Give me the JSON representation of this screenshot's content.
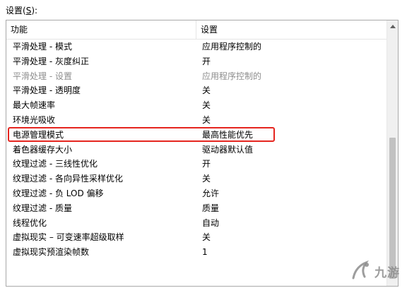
{
  "section_label": {
    "prefix": "设置(",
    "accel": "S",
    "suffix": "):"
  },
  "table": {
    "headers": {
      "feature": "功能",
      "setting": "设置"
    },
    "rows": [
      {
        "feature": "平滑处理 - 模式",
        "setting": "应用程序控制的",
        "disabled": false
      },
      {
        "feature": "平滑处理 - 灰度纠正",
        "setting": "开",
        "disabled": false
      },
      {
        "feature": "平滑处理 - 设置",
        "setting": "应用程序控制的",
        "disabled": true
      },
      {
        "feature": "平滑处理 - 透明度",
        "setting": "关",
        "disabled": false
      },
      {
        "feature": "最大帧速率",
        "setting": "关",
        "disabled": false
      },
      {
        "feature": "环境光吸收",
        "setting": "关",
        "disabled": false
      },
      {
        "feature": "电源管理模式",
        "setting": "最高性能优先",
        "disabled": false,
        "highlighted": true
      },
      {
        "feature": "着色器缓存大小",
        "setting": "驱动器默认值",
        "disabled": false
      },
      {
        "feature": "纹理过滤 - 三线性优化",
        "setting": "开",
        "disabled": false
      },
      {
        "feature": "纹理过滤 - 各向异性采样优化",
        "setting": "关",
        "disabled": false
      },
      {
        "feature": "纹理过滤 - 负 LOD 偏移",
        "setting": "允许",
        "disabled": false
      },
      {
        "feature": "纹理过滤 - 质量",
        "setting": "质量",
        "disabled": false
      },
      {
        "feature": "线程优化",
        "setting": "自动",
        "disabled": false
      },
      {
        "feature": "虚拟现实 – 可变速率超级取样",
        "setting": "关",
        "disabled": false
      },
      {
        "feature": "虚拟现实预渲染帧数",
        "setting": "1",
        "disabled": false
      }
    ]
  },
  "watermark": {
    "text": "九游",
    "icon": "jiuyou-logo-icon"
  },
  "colors": {
    "highlight_border": "#e5251f",
    "disabled_text": "#8d8d8d"
  }
}
